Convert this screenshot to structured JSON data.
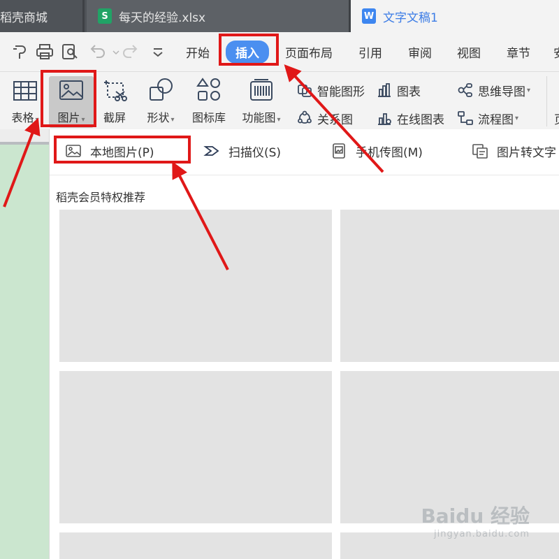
{
  "tabs": [
    {
      "label": "稻壳商城"
    },
    {
      "label": "每天的经验.xlsx",
      "icon": "S"
    },
    {
      "label": "文字文稿1",
      "icon": "W"
    }
  ],
  "menu": [
    {
      "label": "开始"
    },
    {
      "label": "插入"
    },
    {
      "label": "页面布局"
    },
    {
      "label": "引用"
    },
    {
      "label": "审阅"
    },
    {
      "label": "视图"
    },
    {
      "label": "章节"
    },
    {
      "label": "安"
    }
  ],
  "ribbon": {
    "big": [
      {
        "label": "表格"
      },
      {
        "label": "图片"
      },
      {
        "label": "截屏"
      },
      {
        "label": "形状"
      },
      {
        "label": "图标库"
      },
      {
        "label": "功能图"
      }
    ],
    "small": [
      {
        "label": "智能图形"
      },
      {
        "label": "关系图"
      },
      {
        "label": "图表"
      },
      {
        "label": "在线图表"
      },
      {
        "label": "思维导图"
      },
      {
        "label": "流程图"
      },
      {
        "label": "页"
      },
      {
        "label": "页"
      }
    ]
  },
  "dropdown": {
    "items": [
      {
        "label": "本地图片(P)"
      },
      {
        "label": "扫描仪(S)"
      },
      {
        "label": "手机传图(M)"
      },
      {
        "label": "图片转文字"
      }
    ],
    "section_title": "稻壳会员特权推荐"
  },
  "watermark": {
    "line1": "Baidu 经验",
    "line2": "jingyan.baidu.com"
  },
  "colors": {
    "annotation": "#e01818",
    "accent": "#4b8ff0",
    "tabbar": "#4f5358",
    "doc_page": "#cbe6cf"
  }
}
